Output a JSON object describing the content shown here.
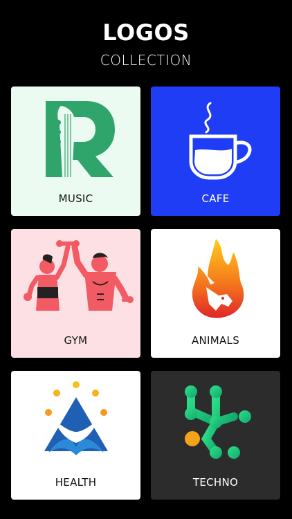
{
  "header": {
    "title": "LOGOS",
    "subtitle": "COLLECTION"
  },
  "cards": [
    {
      "label": "MUSIC",
      "icon": "guitar-r-icon",
      "bg": "#ecfbf1",
      "accent": "#2fa46b"
    },
    {
      "label": "CAFE",
      "icon": "coffee-cup-icon",
      "bg": "#1e3df4",
      "accent": "#ffffff"
    },
    {
      "label": "GYM",
      "icon": "fitness-couple-icon",
      "bg": "#fde0e4",
      "accent": "#f25a64"
    },
    {
      "label": "ANIMALS",
      "icon": "flame-unicorn-icon",
      "bg": "#ffffff",
      "accent": "#f28a1c"
    },
    {
      "label": "HEALTH",
      "icon": "wellness-figure-icon",
      "bg": "#ffffff",
      "accent": "#1f5fb4"
    },
    {
      "label": "TECHNO",
      "icon": "molecule-network-icon",
      "bg": "#2c2c2c",
      "accent": "#19c37a"
    }
  ]
}
